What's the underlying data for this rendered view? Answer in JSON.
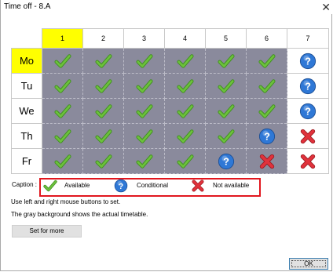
{
  "window": {
    "title": "Time off - 8.A",
    "close_glyph": "✕"
  },
  "columns": [
    "1",
    "2",
    "3",
    "4",
    "5",
    "6",
    "7"
  ],
  "selected_column_index": 0,
  "rows": [
    {
      "label": "Mo",
      "selected": true,
      "cells": [
        "available",
        "available",
        "available",
        "available",
        "available",
        "available",
        "conditional"
      ]
    },
    {
      "label": "Tu",
      "selected": false,
      "cells": [
        "available",
        "available",
        "available",
        "available",
        "available",
        "available",
        "conditional"
      ]
    },
    {
      "label": "We",
      "selected": false,
      "cells": [
        "available",
        "available",
        "available",
        "available",
        "available",
        "available",
        "conditional"
      ]
    },
    {
      "label": "Th",
      "selected": false,
      "cells": [
        "available",
        "available",
        "available",
        "available",
        "available",
        "conditional",
        "not_available"
      ]
    },
    {
      "label": "Fr",
      "selected": false,
      "cells": [
        "available",
        "available",
        "available",
        "available",
        "conditional",
        "not_available",
        "not_available"
      ]
    }
  ],
  "gray_background_columns": [
    0,
    1,
    2,
    3,
    4,
    5
  ],
  "caption": {
    "label": "Caption :",
    "available": "Available",
    "conditional": "Conditional",
    "not_available": "Not available"
  },
  "hints": {
    "line1": "Use left and right mouse buttons to set.",
    "line2": "The gray background shows the actual timetable."
  },
  "buttons": {
    "set_for_more": "Set for more",
    "ok": "OK"
  },
  "colors": {
    "selected_highlight": "#ffff00",
    "timetable_gray": "#8a8a9c",
    "check_green": "#6cc13c",
    "question_blue": "#2f78d6",
    "cross_red": "#e1323c",
    "legend_border": "#e1161e"
  },
  "icons": {
    "available": "checkmark-icon",
    "conditional": "question-icon",
    "not_available": "cross-icon"
  }
}
